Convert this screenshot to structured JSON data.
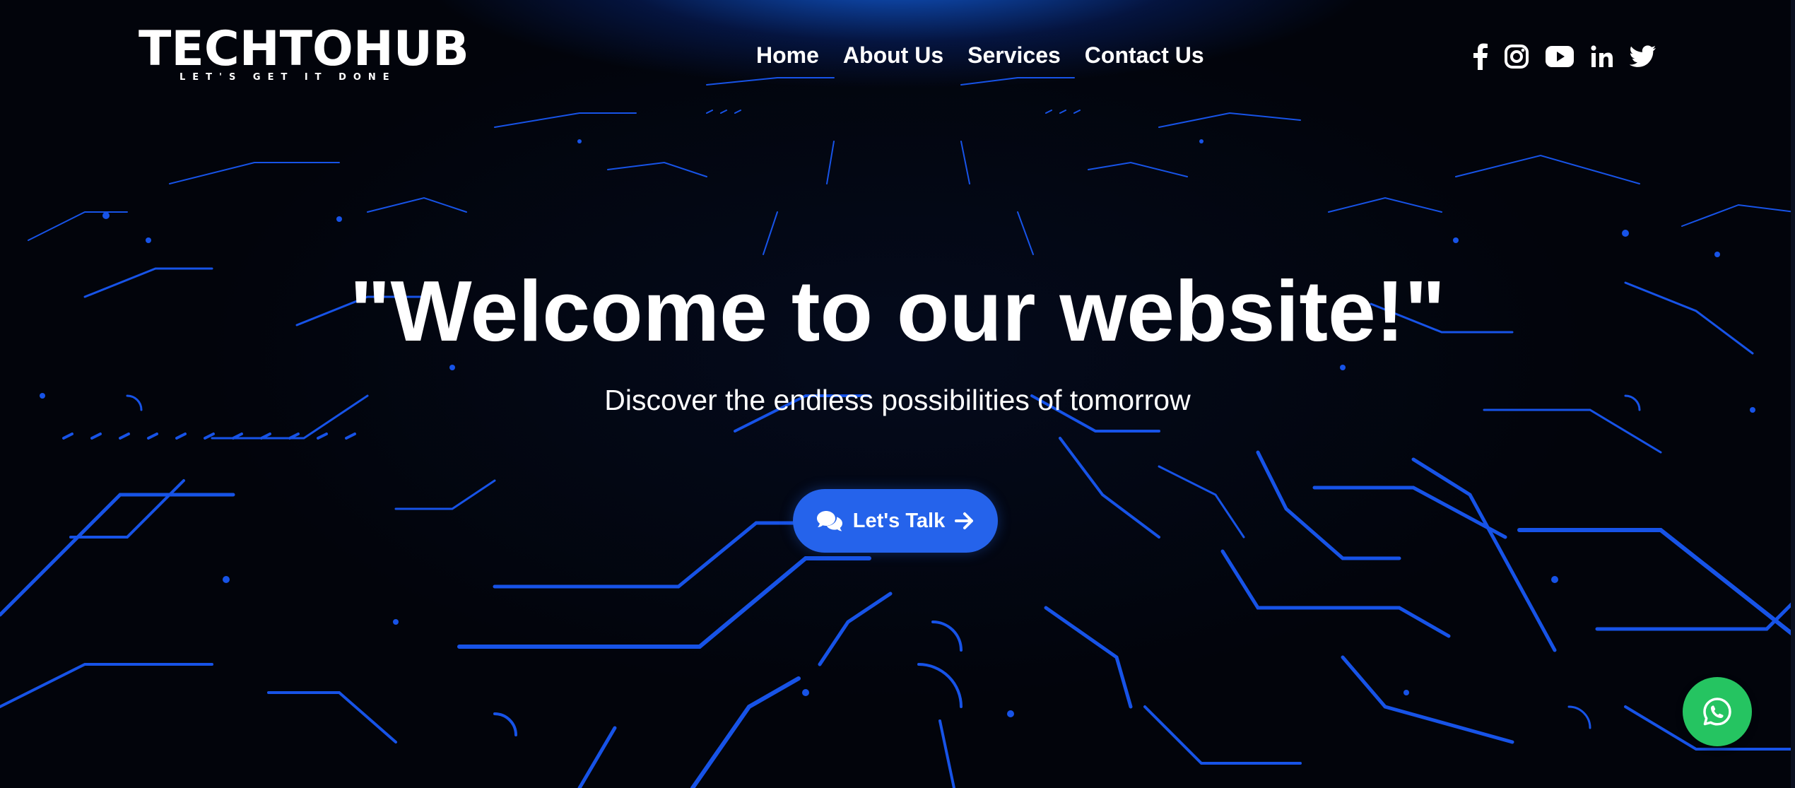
{
  "logo": {
    "name": "TECHTOHUB",
    "tagline": "LET'S GET IT DONE"
  },
  "nav": {
    "items": [
      {
        "label": "Home"
      },
      {
        "label": "About Us"
      },
      {
        "label": "Services"
      },
      {
        "label": "Contact Us"
      }
    ]
  },
  "social": {
    "icons": [
      "facebook-icon",
      "instagram-icon",
      "youtube-icon",
      "linkedin-icon",
      "twitter-icon"
    ]
  },
  "hero": {
    "title": "\"Welcome to our website!\"",
    "subtitle": "Discover the endless possibilities of tomorrow",
    "cta_label": "Let's Talk",
    "cta_icons": [
      "chat-bubbles-icon",
      "arrow-right-icon"
    ]
  },
  "floating": {
    "whatsapp_icon": "whatsapp-icon"
  },
  "colors": {
    "background": "#02040b",
    "circuit": "#1a5cff",
    "accent": "#2563eb",
    "whatsapp": "#25c461",
    "text": "#ffffff"
  }
}
